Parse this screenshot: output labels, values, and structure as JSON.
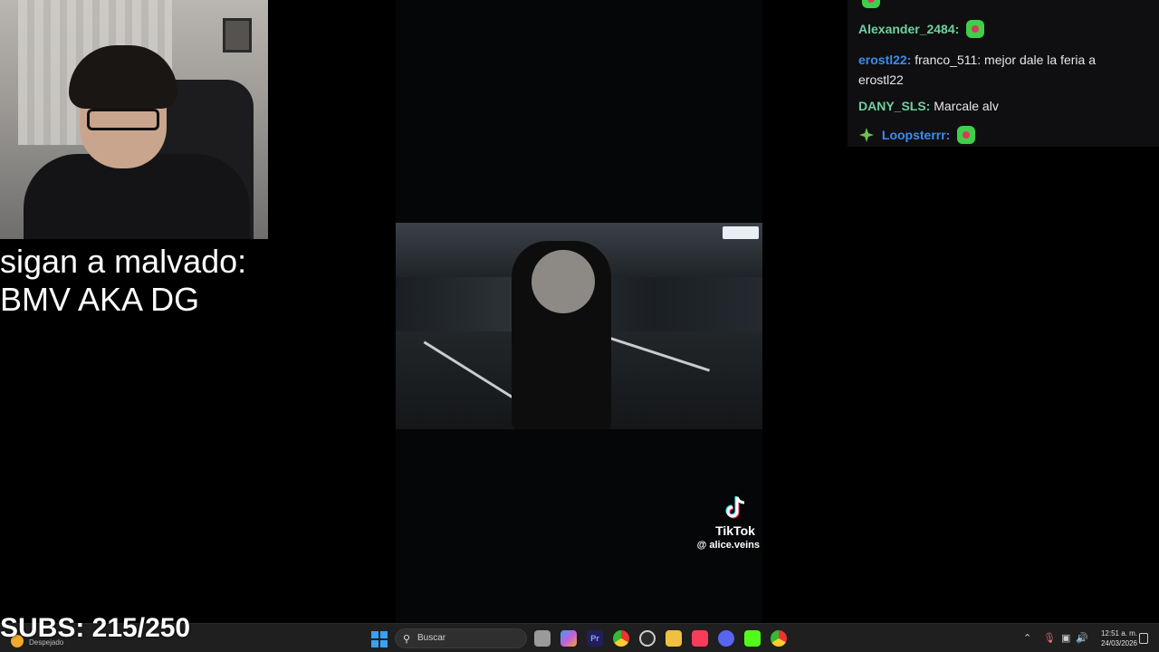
{
  "overlay": {
    "caption_line1": "sigan a malvado:",
    "caption_line2": "BMV AKA DG",
    "subs_label": "SUBS: 215/250"
  },
  "tiktok": {
    "brand": "TikTok",
    "username": "@ alice.veins"
  },
  "chat": {
    "messages": [
      {
        "name": "Alexander_2484:",
        "name_color": "#6fd0a0",
        "text": "",
        "emote": "pepe-emote"
      },
      {
        "name": "erostl22:",
        "name_color": "#3c8cf0",
        "text": "franco_511: mejor dale la feria a erostl22"
      },
      {
        "name": "DANY_SLS:",
        "name_color": "#6fd0a0",
        "text": "Marcale alv"
      },
      {
        "name": "Loopsterrr:",
        "name_color": "#3c8cf0",
        "text": "",
        "emote": "pepe-emote",
        "badge": "prime-badge"
      }
    ]
  },
  "taskbar": {
    "weather_text": "Despejado",
    "search_placeholder": "Buscar",
    "time": "12:51 a. m.",
    "date": "24/03/2026"
  },
  "colors": {
    "background": "#000000",
    "chat_bg": "#0f0f11",
    "taskbar_bg": "#1f1f1f",
    "name_green": "#6fd0a0",
    "name_blue": "#3c8cf0"
  }
}
